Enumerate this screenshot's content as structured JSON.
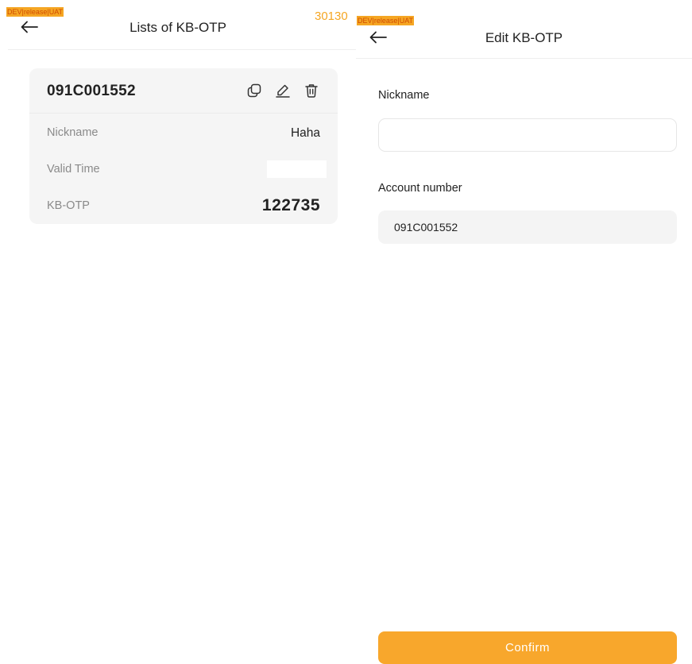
{
  "left": {
    "env_badge": "DEV|release|UAT",
    "build_number": "30130",
    "header": {
      "title": "Lists of KB-OTP"
    },
    "card": {
      "account": "091C001552",
      "rows": [
        {
          "label": "Nickname",
          "value": "Haha"
        },
        {
          "label": "Valid Time",
          "value": ""
        },
        {
          "label": "KB-OTP",
          "value": "122735"
        }
      ]
    }
  },
  "right": {
    "env_badge": "DEV|release|UAT",
    "header": {
      "title": "Edit KB-OTP"
    },
    "form": {
      "nickname_label": "Nickname",
      "nickname_value": "",
      "account_label": "Account number",
      "account_value": "091C001552"
    },
    "confirm_label": "Confirm"
  },
  "colors": {
    "accent": "#f8a72c",
    "badge": "#f5a623"
  },
  "icons": [
    "back-arrow-icon",
    "copy-icon",
    "edit-icon",
    "delete-icon"
  ]
}
